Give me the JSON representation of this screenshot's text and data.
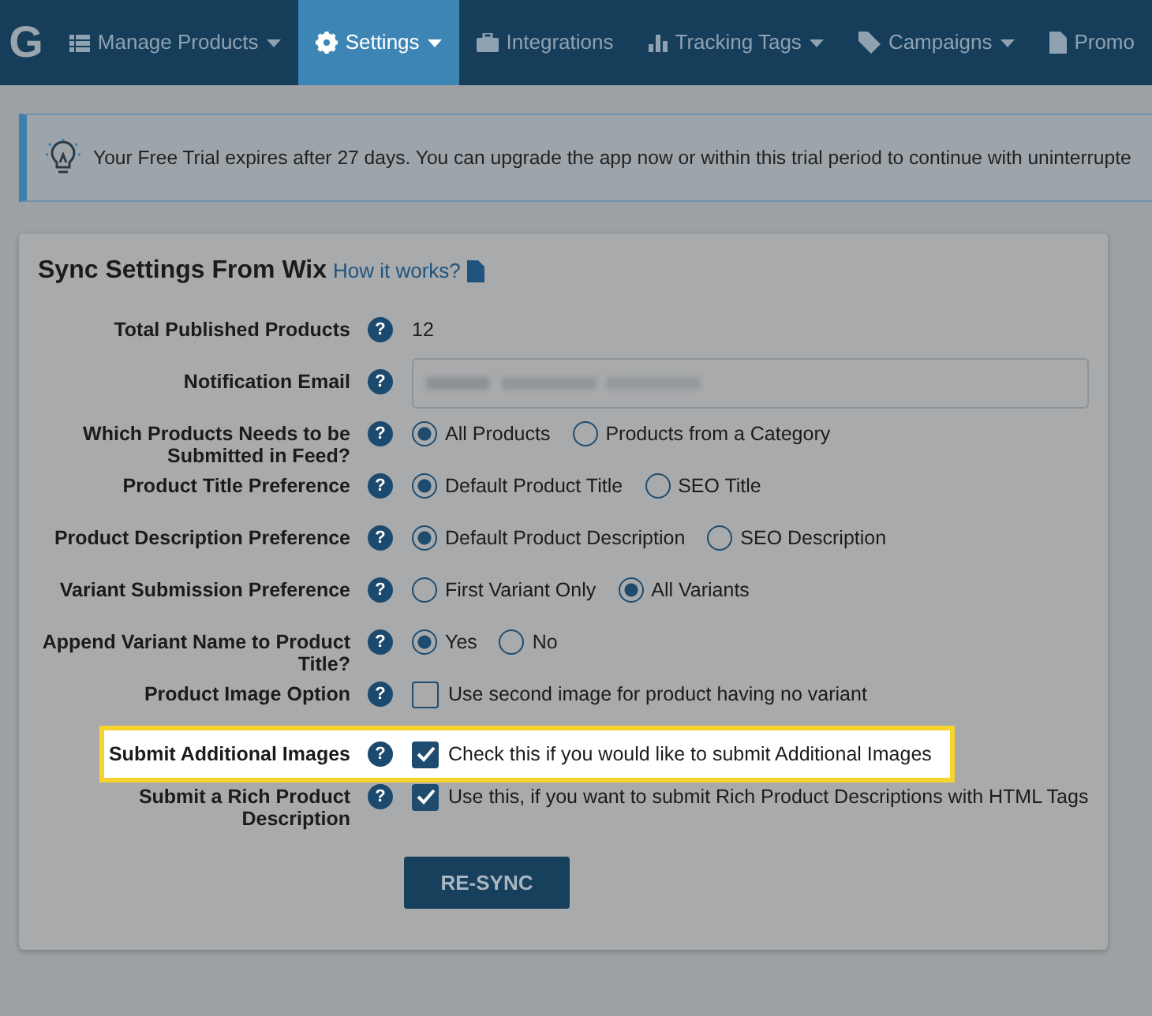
{
  "navbar": {
    "logo": "G",
    "items": [
      {
        "label": "Manage Products",
        "caret": true,
        "selected": false
      },
      {
        "label": "Settings",
        "caret": true,
        "selected": true
      },
      {
        "label": "Integrations",
        "caret": false,
        "selected": false
      },
      {
        "label": "Tracking Tags",
        "caret": true,
        "selected": false
      },
      {
        "label": "Campaigns",
        "caret": true,
        "selected": false
      },
      {
        "label": "Promo",
        "caret": false,
        "selected": false
      }
    ]
  },
  "alert": {
    "text": "Your Free Trial expires after 27 days. You can upgrade the app now or within this trial period to continue with uninterrupte"
  },
  "card": {
    "title": "Sync Settings From Wix",
    "link": "How it works?",
    "fields": [
      {
        "label": "Total Published Products",
        "help": "?",
        "kind": "text",
        "value": "12",
        "highlighted": false
      },
      {
        "label": "Notification Email",
        "help": "?",
        "kind": "input",
        "value_blurred": true,
        "highlighted": false
      },
      {
        "label": "Which Products Needs to be Submitted in Feed?",
        "help": "?",
        "kind": "radio",
        "highlighted": false,
        "options": [
          {
            "label": "All Products",
            "selected": true
          },
          {
            "label": "Products from a Category",
            "selected": false
          }
        ]
      },
      {
        "label": "Product Title Preference",
        "help": "?",
        "kind": "radio",
        "highlighted": false,
        "options": [
          {
            "label": "Default Product Title",
            "selected": true
          },
          {
            "label": "SEO Title",
            "selected": false
          }
        ]
      },
      {
        "label": "Product Description Preference",
        "help": "?",
        "kind": "radio",
        "highlighted": false,
        "options": [
          {
            "label": "Default Product Description",
            "selected": true
          },
          {
            "label": "SEO Description",
            "selected": false
          }
        ]
      },
      {
        "label": "Variant Submission Preference",
        "help": "?",
        "kind": "radio",
        "highlighted": false,
        "options": [
          {
            "label": "First Variant Only",
            "selected": false
          },
          {
            "label": "All Variants",
            "selected": true
          }
        ]
      },
      {
        "label": "Append Variant Name to Product Title?",
        "help": "?",
        "kind": "radio",
        "highlighted": false,
        "options": [
          {
            "label": "Yes",
            "selected": true
          },
          {
            "label": "No",
            "selected": false
          }
        ]
      },
      {
        "label": "Product Image Option",
        "help": "?",
        "kind": "checkbox",
        "highlighted": false,
        "text": "Use second image for product having no variant",
        "checked": false
      },
      {
        "label": "Submit Additional Images",
        "help": "?",
        "kind": "checkbox",
        "highlighted": true,
        "text": "Check this if you would like to submit Additional Images",
        "checked": true
      },
      {
        "label": "Submit a Rich Product Description",
        "help": "?",
        "kind": "checkbox",
        "highlighted": false,
        "text": "Use this, if you want to submit Rich Product Descriptions with HTML Tags",
        "checked": true
      }
    ],
    "button": "RE-SYNC"
  }
}
